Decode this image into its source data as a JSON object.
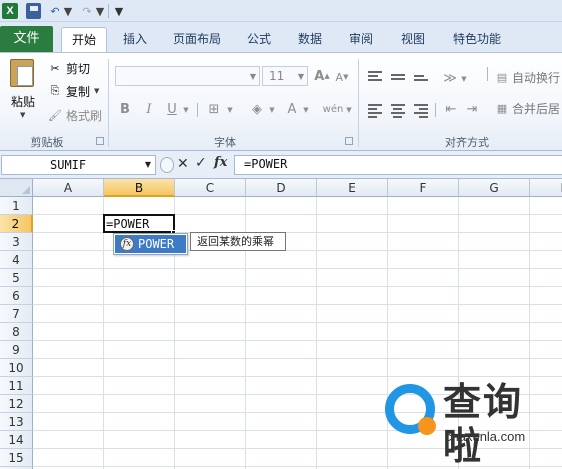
{
  "quick_access": {
    "app_icon": "excel-logo",
    "app_letter": "X",
    "icons": [
      "save-icon",
      "undo-icon",
      "redo-icon",
      "customize-icon"
    ]
  },
  "tabs": [
    "文件",
    "开始",
    "插入",
    "页面布局",
    "公式",
    "数据",
    "审阅",
    "视图",
    "特色功能"
  ],
  "active_tab": "开始",
  "ribbon": {
    "clipboard": {
      "paste": "粘贴",
      "cut": "剪切",
      "copy": "复制",
      "format_painter": "格式刷",
      "group_label": "剪贴板"
    },
    "font": {
      "size": "11",
      "bold": "B",
      "italic": "I",
      "underline": "U",
      "grow": "A",
      "shrink": "A",
      "font_color": "A",
      "phonetic": "wén",
      "group_label": "字体"
    },
    "alignment": {
      "wrap_text": "自动换行",
      "merge_center": "合并后居",
      "group_label": "对齐方式"
    }
  },
  "formula_bar": {
    "name_box": "SUMIF",
    "cancel": "✕",
    "enter": "✓",
    "fx": "fx",
    "formula": "=POWER"
  },
  "sheet": {
    "columns": [
      "A",
      "B",
      "C",
      "D",
      "E",
      "F",
      "G",
      "H"
    ],
    "rows": [
      "1",
      "2",
      "3",
      "4",
      "5",
      "6",
      "7",
      "8",
      "9",
      "10",
      "11",
      "12",
      "13",
      "14",
      "15",
      "16"
    ],
    "active_column": "B",
    "active_row": "2",
    "active_cell_value": "=POWER"
  },
  "autocomplete": {
    "item": "POWER",
    "icon": "fx",
    "tooltip": "返回某数的乘幂"
  },
  "watermark": {
    "title": "查询啦",
    "url": "chaxunla.com"
  },
  "colors": {
    "file_tab": "#2a7d3f",
    "selection_header": "#f5c661",
    "autocomplete_highlight": "#3d7bc6",
    "watermark_blue": "#2196e4",
    "watermark_orange": "#f7941d"
  }
}
